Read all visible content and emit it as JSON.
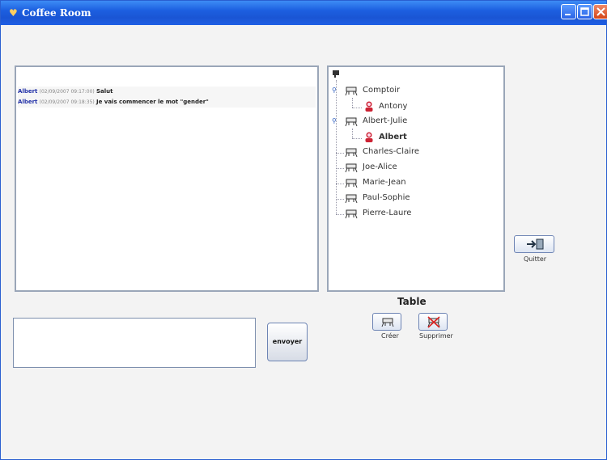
{
  "window": {
    "title": "Coffee Room"
  },
  "chat": {
    "messages": [
      {
        "author": "Albert",
        "timestamp": "(02/09/2007 09:17:00)",
        "text": "Salut"
      },
      {
        "author": "Albert",
        "timestamp": "(02/09/2007 09:18:35)",
        "text": "Je vais commencer le mot \"gender\""
      }
    ]
  },
  "tree": {
    "tables": [
      {
        "name": "Comptoir",
        "expanded": true,
        "members": [
          {
            "name": "Antony",
            "bold": false
          }
        ]
      },
      {
        "name": "Albert-Julie",
        "expanded": true,
        "members": [
          {
            "name": "Albert",
            "bold": true
          }
        ]
      },
      {
        "name": "Charles-Claire",
        "expanded": false,
        "members": []
      },
      {
        "name": "Joe-Alice",
        "expanded": false,
        "members": []
      },
      {
        "name": "Marie-Jean",
        "expanded": false,
        "members": []
      },
      {
        "name": "Paul-Sophie",
        "expanded": false,
        "members": []
      },
      {
        "name": "Pierre-Laure",
        "expanded": false,
        "members": []
      }
    ]
  },
  "table_section": {
    "label": "Table",
    "create_label": "Créer",
    "delete_label": "Supprimer"
  },
  "quit_label": "Quitter",
  "send_label": "envoyer",
  "colors": {
    "titlebar": "#1c5fe0",
    "author": "#2433a8"
  }
}
